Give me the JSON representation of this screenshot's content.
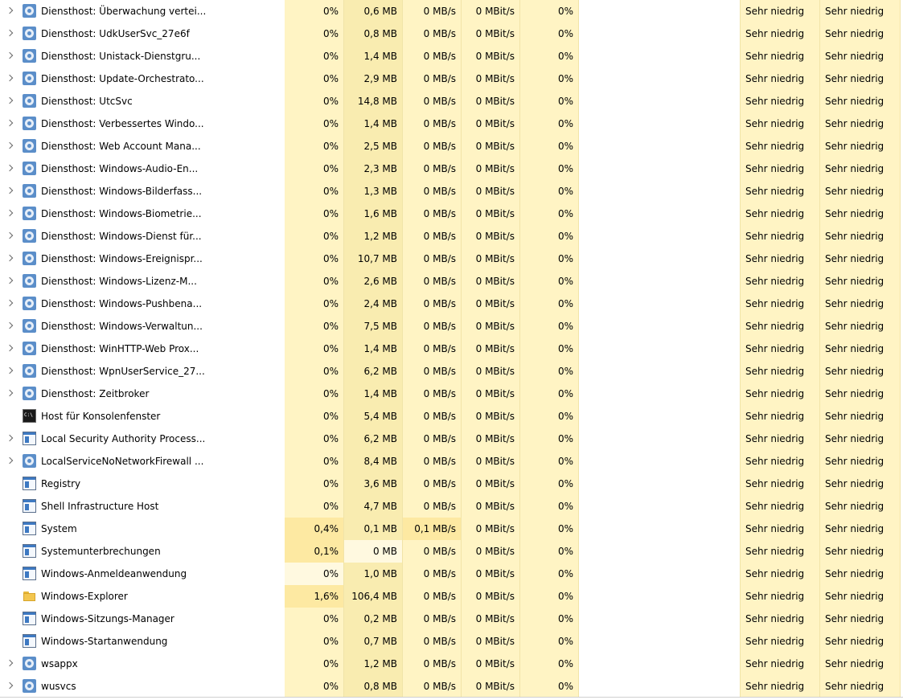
{
  "rows": [
    {
      "name": "Diensthost: Überwachung vertei...",
      "icon": "gear-icon",
      "expandable": true,
      "cpu": "0%",
      "mem": "0,6 MB",
      "disk": "0 MB/s",
      "net": "0 MBit/s",
      "gpu": "0%",
      "power": "Sehr niedrig",
      "power_trend": "Sehr niedrig"
    },
    {
      "name": "Diensthost: UdkUserSvc_27e6f",
      "icon": "gear-icon",
      "expandable": true,
      "cpu": "0%",
      "mem": "0,8 MB",
      "disk": "0 MB/s",
      "net": "0 MBit/s",
      "gpu": "0%",
      "power": "Sehr niedrig",
      "power_trend": "Sehr niedrig"
    },
    {
      "name": "Diensthost: Unistack-Dienstgru...",
      "icon": "gear-icon",
      "expandable": true,
      "cpu": "0%",
      "mem": "1,4 MB",
      "disk": "0 MB/s",
      "net": "0 MBit/s",
      "gpu": "0%",
      "power": "Sehr niedrig",
      "power_trend": "Sehr niedrig"
    },
    {
      "name": "Diensthost: Update-Orchestrato...",
      "icon": "gear-icon",
      "expandable": true,
      "cpu": "0%",
      "mem": "2,9 MB",
      "disk": "0 MB/s",
      "net": "0 MBit/s",
      "gpu": "0%",
      "power": "Sehr niedrig",
      "power_trend": "Sehr niedrig"
    },
    {
      "name": "Diensthost: UtcSvc",
      "icon": "gear-icon",
      "expandable": true,
      "cpu": "0%",
      "mem": "14,8 MB",
      "disk": "0 MB/s",
      "net": "0 MBit/s",
      "gpu": "0%",
      "power": "Sehr niedrig",
      "power_trend": "Sehr niedrig"
    },
    {
      "name": "Diensthost: Verbessertes Windo...",
      "icon": "gear-icon",
      "expandable": true,
      "cpu": "0%",
      "mem": "1,4 MB",
      "disk": "0 MB/s",
      "net": "0 MBit/s",
      "gpu": "0%",
      "power": "Sehr niedrig",
      "power_trend": "Sehr niedrig"
    },
    {
      "name": "Diensthost: Web Account Mana...",
      "icon": "gear-icon",
      "expandable": true,
      "cpu": "0%",
      "mem": "2,5 MB",
      "disk": "0 MB/s",
      "net": "0 MBit/s",
      "gpu": "0%",
      "power": "Sehr niedrig",
      "power_trend": "Sehr niedrig"
    },
    {
      "name": "Diensthost: Windows-Audio-En...",
      "icon": "gear-icon",
      "expandable": true,
      "cpu": "0%",
      "mem": "2,3 MB",
      "disk": "0 MB/s",
      "net": "0 MBit/s",
      "gpu": "0%",
      "power": "Sehr niedrig",
      "power_trend": "Sehr niedrig"
    },
    {
      "name": "Diensthost: Windows-Bilderfass...",
      "icon": "gear-icon",
      "expandable": true,
      "cpu": "0%",
      "mem": "1,3 MB",
      "disk": "0 MB/s",
      "net": "0 MBit/s",
      "gpu": "0%",
      "power": "Sehr niedrig",
      "power_trend": "Sehr niedrig"
    },
    {
      "name": "Diensthost: Windows-Biometrie...",
      "icon": "gear-icon",
      "expandable": true,
      "cpu": "0%",
      "mem": "1,6 MB",
      "disk": "0 MB/s",
      "net": "0 MBit/s",
      "gpu": "0%",
      "power": "Sehr niedrig",
      "power_trend": "Sehr niedrig"
    },
    {
      "name": "Diensthost: Windows-Dienst für...",
      "icon": "gear-icon",
      "expandable": true,
      "cpu": "0%",
      "mem": "1,2 MB",
      "disk": "0 MB/s",
      "net": "0 MBit/s",
      "gpu": "0%",
      "power": "Sehr niedrig",
      "power_trend": "Sehr niedrig"
    },
    {
      "name": "Diensthost: Windows-Ereignispr...",
      "icon": "gear-icon",
      "expandable": true,
      "cpu": "0%",
      "mem": "10,7 MB",
      "disk": "0 MB/s",
      "net": "0 MBit/s",
      "gpu": "0%",
      "power": "Sehr niedrig",
      "power_trend": "Sehr niedrig"
    },
    {
      "name": "Diensthost: Windows-Lizenz-M...",
      "icon": "gear-icon",
      "expandable": true,
      "cpu": "0%",
      "mem": "2,6 MB",
      "disk": "0 MB/s",
      "net": "0 MBit/s",
      "gpu": "0%",
      "power": "Sehr niedrig",
      "power_trend": "Sehr niedrig"
    },
    {
      "name": "Diensthost: Windows-Pushbena...",
      "icon": "gear-icon",
      "expandable": true,
      "cpu": "0%",
      "mem": "2,4 MB",
      "disk": "0 MB/s",
      "net": "0 MBit/s",
      "gpu": "0%",
      "power": "Sehr niedrig",
      "power_trend": "Sehr niedrig"
    },
    {
      "name": "Diensthost: Windows-Verwaltun...",
      "icon": "gear-icon",
      "expandable": true,
      "cpu": "0%",
      "mem": "7,5 MB",
      "disk": "0 MB/s",
      "net": "0 MBit/s",
      "gpu": "0%",
      "power": "Sehr niedrig",
      "power_trend": "Sehr niedrig"
    },
    {
      "name": "Diensthost: WinHTTP-Web Prox...",
      "icon": "gear-icon",
      "expandable": true,
      "cpu": "0%",
      "mem": "1,4 MB",
      "disk": "0 MB/s",
      "net": "0 MBit/s",
      "gpu": "0%",
      "power": "Sehr niedrig",
      "power_trend": "Sehr niedrig"
    },
    {
      "name": "Diensthost: WpnUserService_27...",
      "icon": "gear-icon",
      "expandable": true,
      "cpu": "0%",
      "mem": "6,2 MB",
      "disk": "0 MB/s",
      "net": "0 MBit/s",
      "gpu": "0%",
      "power": "Sehr niedrig",
      "power_trend": "Sehr niedrig"
    },
    {
      "name": "Diensthost: Zeitbroker",
      "icon": "gear-icon",
      "expandable": true,
      "cpu": "0%",
      "mem": "1,4 MB",
      "disk": "0 MB/s",
      "net": "0 MBit/s",
      "gpu": "0%",
      "power": "Sehr niedrig",
      "power_trend": "Sehr niedrig"
    },
    {
      "name": "Host für Konsolenfenster",
      "icon": "console-icon",
      "expandable": false,
      "cpu": "0%",
      "mem": "5,4 MB",
      "disk": "0 MB/s",
      "net": "0 MBit/s",
      "gpu": "0%",
      "power": "Sehr niedrig",
      "power_trend": "Sehr niedrig"
    },
    {
      "name": "Local Security Authority Process...",
      "icon": "window-icon",
      "expandable": true,
      "cpu": "0%",
      "mem": "6,2 MB",
      "disk": "0 MB/s",
      "net": "0 MBit/s",
      "gpu": "0%",
      "power": "Sehr niedrig",
      "power_trend": "Sehr niedrig"
    },
    {
      "name": "LocalServiceNoNetworkFirewall ...",
      "icon": "gear-icon",
      "expandable": true,
      "cpu": "0%",
      "mem": "8,4 MB",
      "disk": "0 MB/s",
      "net": "0 MBit/s",
      "gpu": "0%",
      "power": "Sehr niedrig",
      "power_trend": "Sehr niedrig"
    },
    {
      "name": "Registry",
      "icon": "window-icon",
      "expandable": false,
      "cpu": "0%",
      "mem": "3,6 MB",
      "disk": "0 MB/s",
      "net": "0 MBit/s",
      "gpu": "0%",
      "power": "Sehr niedrig",
      "power_trend": "Sehr niedrig"
    },
    {
      "name": "Shell Infrastructure Host",
      "icon": "window-icon",
      "expandable": false,
      "cpu": "0%",
      "mem": "4,7 MB",
      "disk": "0 MB/s",
      "net": "0 MBit/s",
      "gpu": "0%",
      "power": "Sehr niedrig",
      "power_trend": "Sehr niedrig"
    },
    {
      "name": "System",
      "icon": "window-icon",
      "expandable": false,
      "cpu": "0,4%",
      "mem": "0,1 MB",
      "disk": "0,1 MB/s",
      "net": "0 MBit/s",
      "gpu": "0%",
      "power": "Sehr niedrig",
      "power_trend": "Sehr niedrig",
      "hl_cpu": true,
      "hl_disk": true
    },
    {
      "name": "Systemunterbrechungen",
      "icon": "window-icon",
      "expandable": false,
      "cpu": "0,1%",
      "mem": "0 MB",
      "disk": "0 MB/s",
      "net": "0 MBit/s",
      "gpu": "0%",
      "power": "Sehr niedrig",
      "power_trend": "Sehr niedrig",
      "hl_cpu": true,
      "hl_mem_light": true
    },
    {
      "name": "Windows-Anmeldeanwendung",
      "icon": "window-icon",
      "expandable": false,
      "cpu": "0%",
      "mem": "1,0 MB",
      "disk": "0 MB/s",
      "net": "0 MBit/s",
      "gpu": "0%",
      "power": "Sehr niedrig",
      "power_trend": "Sehr niedrig",
      "hl_cpu_light": true
    },
    {
      "name": "Windows-Explorer",
      "icon": "folder-icon",
      "expandable": false,
      "cpu": "1,6%",
      "mem": "106,4 MB",
      "disk": "0 MB/s",
      "net": "0 MBit/s",
      "gpu": "0%",
      "power": "Sehr niedrig",
      "power_trend": "Sehr niedrig",
      "hl_cpu": true
    },
    {
      "name": "Windows-Sitzungs-Manager",
      "icon": "window-icon",
      "expandable": false,
      "cpu": "0%",
      "mem": "0,2 MB",
      "disk": "0 MB/s",
      "net": "0 MBit/s",
      "gpu": "0%",
      "power": "Sehr niedrig",
      "power_trend": "Sehr niedrig"
    },
    {
      "name": "Windows-Startanwendung",
      "icon": "window-icon",
      "expandable": false,
      "cpu": "0%",
      "mem": "0,7 MB",
      "disk": "0 MB/s",
      "net": "0 MBit/s",
      "gpu": "0%",
      "power": "Sehr niedrig",
      "power_trend": "Sehr niedrig"
    },
    {
      "name": "wsappx",
      "icon": "gear-icon",
      "expandable": true,
      "cpu": "0%",
      "mem": "1,2 MB",
      "disk": "0 MB/s",
      "net": "0 MBit/s",
      "gpu": "0%",
      "power": "Sehr niedrig",
      "power_trend": "Sehr niedrig"
    },
    {
      "name": "wusvcs",
      "icon": "gear-icon",
      "expandable": true,
      "cpu": "0%",
      "mem": "0,8 MB",
      "disk": "0 MB/s",
      "net": "0 MBit/s",
      "gpu": "0%",
      "power": "Sehr niedrig",
      "power_trend": "Sehr niedrig"
    }
  ]
}
